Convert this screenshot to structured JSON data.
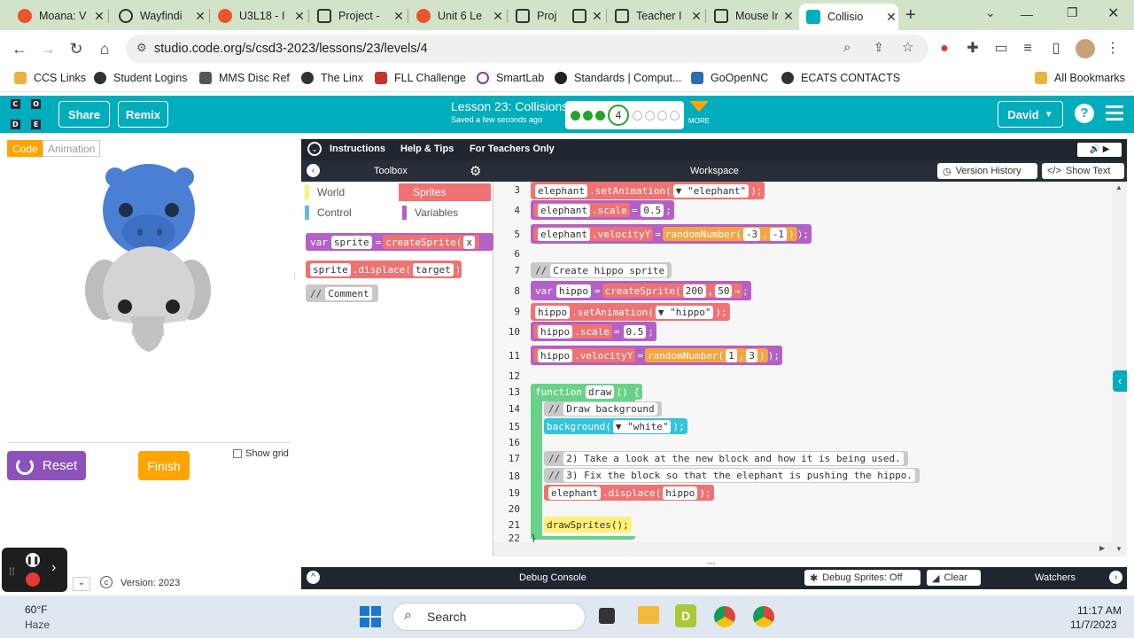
{
  "browser": {
    "tabs": [
      {
        "label": "Moana: V",
        "color": "#e8562a"
      },
      {
        "label": "Wayfindi",
        "color": "#333333"
      },
      {
        "label": "U3L18 - I",
        "color": "#e8562a"
      },
      {
        "label": "Project -",
        "color": "#333333"
      },
      {
        "label": "Unit 6 Le",
        "color": "#e8562a"
      },
      {
        "label": "Proj",
        "color": "#333333"
      },
      {
        "label": "Teacher I",
        "color": "#333333"
      },
      {
        "label": "Mouse Ir",
        "color": "#333333"
      },
      {
        "label": "Collisio",
        "color": "#00adbc"
      }
    ],
    "url": "studio.code.org/s/csd3-2023/lessons/23/levels/4",
    "bookmarks": [
      {
        "label": "CCS Links",
        "color": "#e8b440"
      },
      {
        "label": "Student Logins",
        "color": "#333333"
      },
      {
        "label": "MMS Disc Ref",
        "color": "#555555"
      },
      {
        "label": "The Linx",
        "color": "#333333"
      },
      {
        "label": "FLL Challenge",
        "color": "#c0392b"
      },
      {
        "label": "SmartLab",
        "color": "#7b3fa0"
      },
      {
        "label": "Standards | Comput...",
        "color": "#222222"
      },
      {
        "label": "GoOpenNC",
        "color": "#2c6db0"
      },
      {
        "label": "ECATS CONTACTS",
        "color": "#333333"
      }
    ],
    "all_bookmarks": "All Bookmarks"
  },
  "header": {
    "share": "Share",
    "remix": "Remix",
    "lesson_title": "Lesson 23: Collisions",
    "saved": "Saved a few seconds ago",
    "current_level": "4",
    "more": "MORE",
    "user": "David",
    "logo_letters": [
      "C",
      "O",
      "D",
      "E"
    ]
  },
  "app": {
    "mode_code": "Code",
    "mode_animation": "Animation",
    "reset": "Reset",
    "finish": "Finish",
    "show_grid": "Show grid",
    "version": "Version: 2023"
  },
  "instructions_bar": {
    "instructions": "Instructions",
    "help_tips": "Help & Tips",
    "for_teachers": "For Teachers Only"
  },
  "toolbox": {
    "title": "Toolbox",
    "categories": [
      {
        "label": "World",
        "color": "#fff176"
      },
      {
        "label": "Sprites",
        "color": "#ef7373"
      },
      {
        "label": "Control",
        "color": "#64b5f6"
      },
      {
        "label": "Variables",
        "color": "#b360c7"
      }
    ],
    "blocks": {
      "var_kw": "var",
      "var_name": "sprite",
      "eq": "=",
      "create": "createSprite",
      "create_args": "x",
      "displace_obj": "sprite",
      "displace_fn": ".displace(",
      "displace_arg": "target",
      "displace_end": ")",
      "comment_slash": "//",
      "comment_text": "Comment"
    }
  },
  "workspace": {
    "title": "Workspace",
    "version_history": "Version History",
    "show_text": "Show Text",
    "lines": {
      "l3": {
        "num": "3",
        "obj": "elephant",
        "fn": ".setAnimation(",
        "arg": "\"elephant\"",
        "end": ");"
      },
      "l4": {
        "num": "4",
        "obj": "elephant",
        "fn": ".scale",
        "eq": "=",
        "val": "0.5",
        "end": ";"
      },
      "l5": {
        "num": "5",
        "obj": "elephant",
        "fn": ".velocityY",
        "eq": "=",
        "call": "randomNumber(",
        "a1": "-3",
        "a2": "-1",
        "end": ");"
      },
      "l6": {
        "num": "6"
      },
      "l7": {
        "num": "7",
        "slash": "//",
        "text": "Create hippo sprite"
      },
      "l8": {
        "num": "8",
        "kw": "var",
        "name": "hippo",
        "eq": "=",
        "call": "createSprite(",
        "a1": "200",
        "a2": "50",
        "end": ";"
      },
      "l9": {
        "num": "9",
        "obj": "hippo",
        "fn": ".setAnimation(",
        "arg": "\"hippo\"",
        "end": ");"
      },
      "l10": {
        "num": "10",
        "obj": "hippo",
        "fn": ".scale",
        "eq": "=",
        "val": "0.5",
        "end": ";"
      },
      "l11": {
        "num": "11",
        "obj": "hippo",
        "fn": ".velocityY",
        "eq": "=",
        "call": "randomNumber(",
        "a1": "1",
        "a2": "3",
        "end": ");"
      },
      "l12": {
        "num": "12"
      },
      "l13": {
        "num": "13",
        "kw": "function",
        "name": "draw",
        "end": "() {"
      },
      "l14": {
        "num": "14",
        "slash": "//",
        "text": "Draw background"
      },
      "l15": {
        "num": "15",
        "fn": "background(",
        "arg": "\"white\"",
        "end": ");"
      },
      "l16": {
        "num": "16"
      },
      "l17": {
        "num": "17",
        "slash": "//",
        "text": "2) Take a look at the new block and how it is being used."
      },
      "l18": {
        "num": "18",
        "slash": "//",
        "text": "3) Fix the block so that the elephant is pushing the hippo."
      },
      "l19": {
        "num": "19",
        "obj": "elephant",
        "fn": ".displace(",
        "arg": "hippo",
        "end": ");"
      },
      "l20": {
        "num": "20"
      },
      "l21": {
        "num": "21",
        "fn": "drawSprites();"
      },
      "l22": {
        "num": "22",
        "end": "}"
      }
    }
  },
  "debug": {
    "console": "Debug Console",
    "debug_sprites": "Debug Sprites: Off",
    "clear": "Clear",
    "watchers": "Watchers"
  },
  "taskbar": {
    "temp": "60°F",
    "weather": "Haze",
    "search": "Search",
    "time": "11:17 AM",
    "date": "11/7/2023"
  }
}
